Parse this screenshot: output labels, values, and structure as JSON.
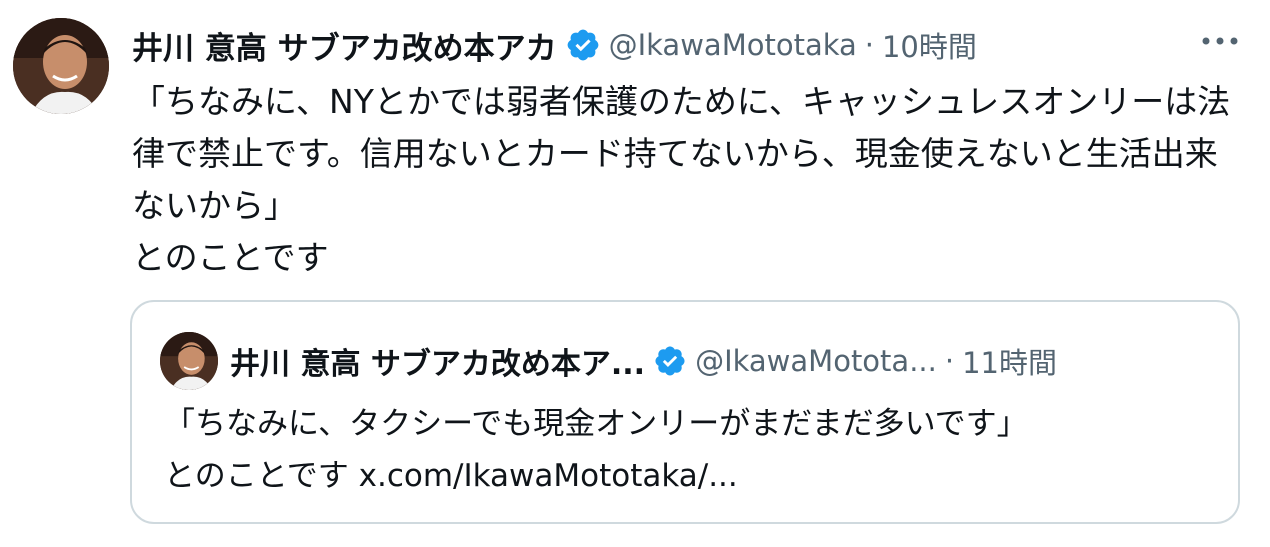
{
  "tweet": {
    "display_name": "井川 意高 サブアカ改め本アカ",
    "handle": "@IkawaMototaka",
    "separator": "·",
    "time": "10時間",
    "text": "「ちなみに、NYとかでは弱者保護のために、キャッシュレスオンリーは法律で禁止です。信用ないとカード持てないから、現金使えないと生活出来ないから」\nとのことです"
  },
  "quote": {
    "display_name": "井川 意高 サブアカ改め本ア...",
    "handle": "@IkawaMototа...",
    "separator": "·",
    "time": "11時間",
    "text": "「ちなみに、タクシーでも現金オンリーがまだまだ多いです」\nとのことです",
    "link": "x.com/IkawaMototaka/..."
  },
  "colors": {
    "verified_badge": "#1d9bf0",
    "secondary_text": "#536471",
    "border": "#cfd9de"
  },
  "icons": {
    "avatar": "profile-photo",
    "verified": "verified-badge-icon",
    "more": "more-options-icon"
  }
}
